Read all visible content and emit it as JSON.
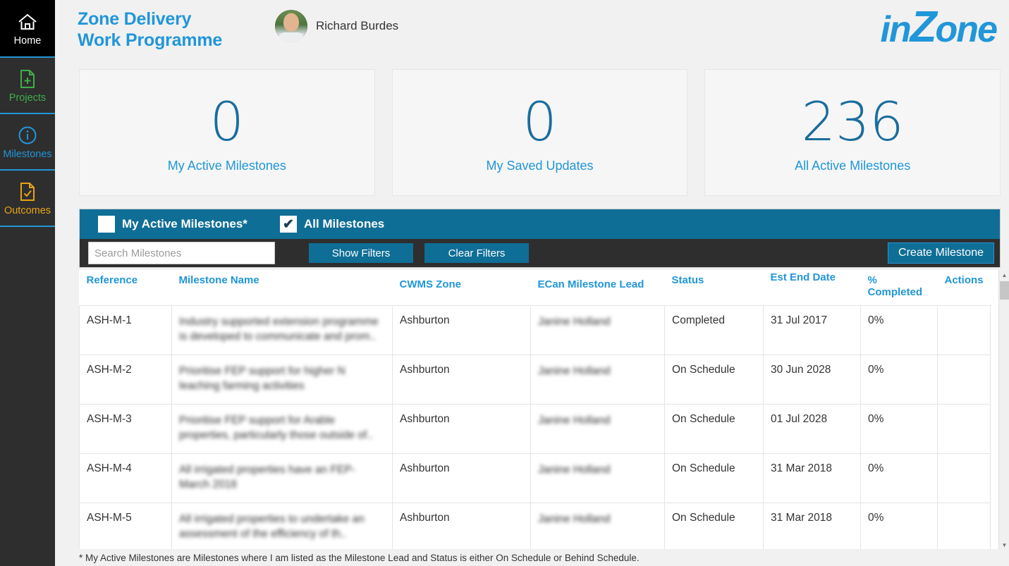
{
  "sidebar": {
    "items": [
      {
        "label": "Home",
        "icon": "home-icon"
      },
      {
        "label": "Projects",
        "icon": "document-plus-icon"
      },
      {
        "label": "Milestones",
        "icon": "info-circle-icon"
      },
      {
        "label": "Outcomes",
        "icon": "document-check-icon"
      }
    ]
  },
  "header": {
    "title_line1": "Zone Delivery",
    "title_line2": "Work Programme",
    "user_name": "Richard Burdes",
    "logo_pre": "in",
    "logo_z": "Z",
    "logo_post": "one"
  },
  "cards": [
    {
      "value": "0",
      "label": "My Active Milestones"
    },
    {
      "value": "0",
      "label": "My Saved Updates"
    },
    {
      "value": "236",
      "label": "All Active Milestones"
    }
  ],
  "filters": {
    "my_active_label": "My Active Milestones*",
    "my_active_checked": false,
    "all_label": "All Milestones",
    "all_checked": true,
    "all_check_glyph": "✔",
    "search_placeholder": "Search Milestones",
    "search_value": "",
    "show_filters_label": "Show Filters",
    "clear_filters_label": "Clear Filters",
    "create_label": "Create Milestone"
  },
  "table": {
    "columns": [
      "Reference",
      "Milestone Name",
      "CWMS Zone",
      "ECan Milestone Lead",
      "Status",
      "Est End Date",
      "% Completed",
      "Actions"
    ],
    "rows": [
      {
        "reference": "ASH-M-1",
        "name": "Industry supported extension programme is developed to communicate and prom..",
        "zone": "Ashburton",
        "lead": "Janine Holland",
        "status": "Completed",
        "end_date": "31 Jul 2017",
        "completed": "0%",
        "actions": ""
      },
      {
        "reference": "ASH-M-2",
        "name": "Prioritise FEP support for higher N leaching farming activities",
        "zone": "Ashburton",
        "lead": "Janine Holland",
        "status": "On Schedule",
        "end_date": "30 Jun 2028",
        "completed": "0%",
        "actions": ""
      },
      {
        "reference": "ASH-M-3",
        "name": "Prioritise FEP support for Arable properties, particularly those outside of..",
        "zone": "Ashburton",
        "lead": "Janine Holland",
        "status": "On Schedule",
        "end_date": "01 Jul 2028",
        "completed": "0%",
        "actions": ""
      },
      {
        "reference": "ASH-M-4",
        "name": "All irrigated properties have an FEP- March 2018",
        "zone": "Ashburton",
        "lead": "Janine Holland",
        "status": "On Schedule",
        "end_date": "31 Mar 2018",
        "completed": "0%",
        "actions": ""
      },
      {
        "reference": "ASH-M-5",
        "name": "All irrigated properties to undertake an assessment of the efficiency of th..",
        "zone": "Ashburton",
        "lead": "Janine Holland",
        "status": "On Schedule",
        "end_date": "31 Mar 2018",
        "completed": "0%",
        "actions": ""
      }
    ]
  },
  "footer": {
    "note": "* My Active Milestones are Milestones where I am listed as the Milestone Lead and Status is either On Schedule or Behind Schedule."
  },
  "colors": {
    "accent_blue": "#2196d8",
    "deep_blue": "#0f6e96",
    "num_blue": "#1a6d9e",
    "green": "#3fae49",
    "orange": "#e8a317",
    "dark": "#2e2e2e"
  }
}
